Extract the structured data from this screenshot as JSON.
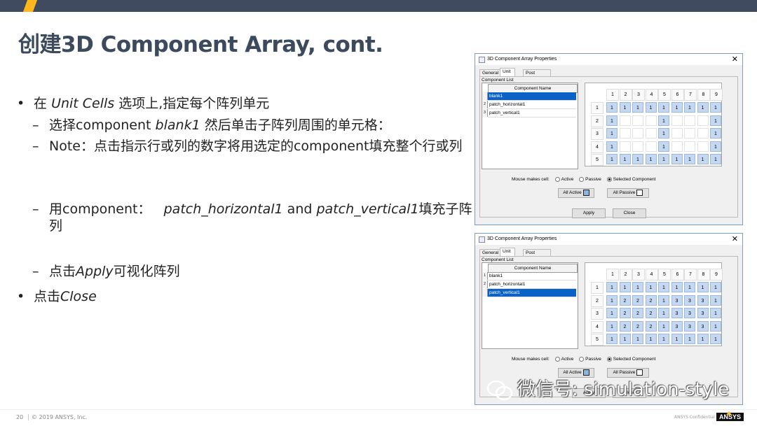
{
  "slide": {
    "title_cn": "创建",
    "title_en": "3D Component Array, cont.",
    "page": "20",
    "copyright": "© 2019 ANSYS, Inc.",
    "confidential": "ANSYS Confidential",
    "logo": "ANSYS"
  },
  "bullets": {
    "b1_pre": "在",
    "b1_em": "Unit Cells",
    "b1_post": "选项上,指定每个阵列单元",
    "b1a_pre": "选择component",
    "b1a_em": "blank1",
    "b1a_post": "然后单击子阵列周围的单元格：",
    "b1b": "Note：点击指示行或列的数字将用选定的component填充整个行或列",
    "b1c_pre": "用component：",
    "b1c_em1": "patch_horizontal1",
    "b1c_and": "and",
    "b1c_em2": "patch_vertical1",
    "b1c_post": "填充子阵列",
    "b1d_pre": "点击",
    "b1d_em": "Apply",
    "b1d_post": "可视化阵列",
    "b2_pre": "点击",
    "b2_em": "Close",
    "dash": "–",
    "dot": "•"
  },
  "dialog": {
    "title": "3D Component Array Properties",
    "close": "✕",
    "tabs": [
      "General",
      "Unit Cells",
      "Post Processing"
    ],
    "component_list_label": "Component List",
    "component_header": "Component Name",
    "components": [
      "blank1",
      "patch_horizontal1",
      "patch_vertical1"
    ],
    "row_numbers": [
      "1",
      "2",
      "3"
    ],
    "col_headers": [
      "1",
      "2",
      "3",
      "4",
      "5",
      "6",
      "7",
      "8",
      "9"
    ],
    "row_headers": [
      "1",
      "2",
      "3",
      "4",
      "5"
    ],
    "mouse_label": "Mouse makes cell:",
    "opt_active": "Active",
    "opt_passive": "Passive",
    "opt_selected": "Selected Component",
    "all_active": "All Active",
    "all_passive": "All Passive",
    "apply": "Apply",
    "close_btn": "Close"
  },
  "dialog1": {
    "selected_index": 0,
    "grid": [
      [
        "1",
        "1",
        "1",
        "1",
        "1",
        "1",
        "1",
        "1",
        "1"
      ],
      [
        "1",
        "",
        "",
        "",
        "1",
        "",
        "",
        "",
        "1"
      ],
      [
        "1",
        "",
        "",
        "",
        "1",
        "",
        "",
        "",
        "1"
      ],
      [
        "1",
        "",
        "",
        "",
        "1",
        "",
        "",
        "",
        "1"
      ],
      [
        "1",
        "1",
        "1",
        "1",
        "1",
        "1",
        "1",
        "1",
        "1"
      ]
    ]
  },
  "dialog2": {
    "selected_index": 2,
    "grid": [
      [
        "1",
        "1",
        "1",
        "1",
        "1",
        "1",
        "1",
        "1",
        "1"
      ],
      [
        "1",
        "2",
        "2",
        "2",
        "1",
        "3",
        "3",
        "3",
        "1"
      ],
      [
        "1",
        "2",
        "2",
        "2",
        "1",
        "3",
        "3",
        "3",
        "1"
      ],
      [
        "1",
        "2",
        "2",
        "2",
        "1",
        "3",
        "3",
        "3",
        "1"
      ],
      [
        "1",
        "1",
        "1",
        "1",
        "1",
        "1",
        "1",
        "1",
        "1"
      ]
    ]
  },
  "watermark": "微信号: simulation-style"
}
